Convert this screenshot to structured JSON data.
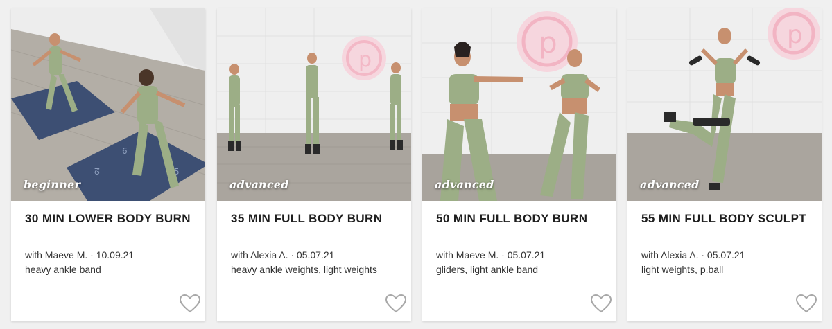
{
  "cards": [
    {
      "level": "beginner",
      "title": "30 MIN LOWER BODY BURN",
      "meta": "with Maeve M. · 10.09.21",
      "equipment": "heavy ankle band",
      "favorite_icon": "heart-outline-icon"
    },
    {
      "level": "advanced",
      "title": "35 MIN FULL BODY BURN",
      "meta": "with Alexia A. · 05.07.21",
      "equipment": "heavy ankle weights, light weights",
      "favorite_icon": "heart-outline-icon"
    },
    {
      "level": "advanced",
      "title": "50 MIN FULL BODY BURN",
      "meta": "with Maeve M. · 05.07.21",
      "equipment": "gliders, light ankle band",
      "favorite_icon": "heart-outline-icon"
    },
    {
      "level": "advanced",
      "title": "55 MIN FULL BODY SCULPT",
      "meta": "with Alexia A. · 05.07.21",
      "equipment": "light weights, p.ball",
      "favorite_icon": "heart-outline-icon"
    }
  ],
  "colors": {
    "outfit_green": "#9cae86",
    "floor_wood": "#a9a49d",
    "wall": "#ececec",
    "mat_blue": "#3d4f73",
    "logo_pink": "#f3c9d4",
    "heart_gray": "#a8a8a8"
  }
}
